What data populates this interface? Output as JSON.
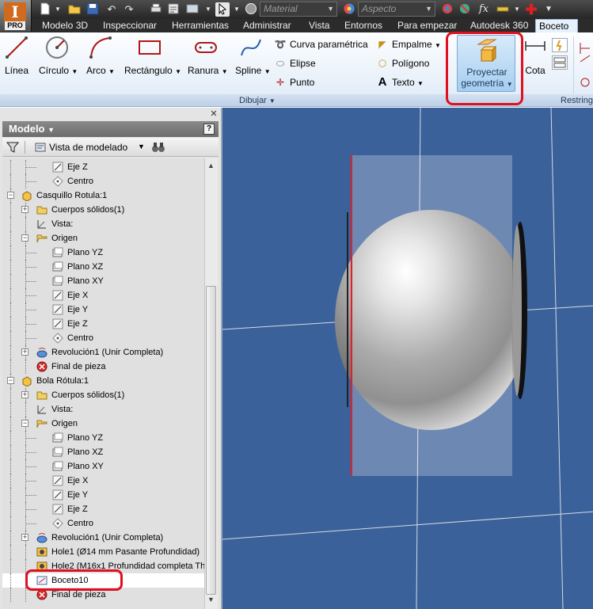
{
  "qat": {
    "material_placeholder": "Material",
    "aspecto_placeholder": "Aspecto",
    "app_badge": "PRO",
    "app_letter": "I",
    "fx_symbol": "fx"
  },
  "tabs": [
    "Modelo 3D",
    "Inspeccionar",
    "Herramientas",
    "Administrar",
    "Vista",
    "Entornos",
    "Para empezar",
    "Autodesk 360",
    "Boceto"
  ],
  "active_tab": "Boceto",
  "ribbon": {
    "draw_buttons": [
      "Línea",
      "Círculo",
      "Arco",
      "Rectángulo",
      "Ranura",
      "Spline"
    ],
    "small_col1": [
      "Curva paramétrica",
      "Elipse",
      "Punto"
    ],
    "small_col2": [
      "Empalme",
      "Polígono",
      "Texto"
    ],
    "project": {
      "line1": "Proyectar",
      "line2": "geometría"
    },
    "cota": "Cota",
    "panel_dibujar": "Dibujar",
    "panel_restring": "Restring"
  },
  "browser": {
    "title": "Modelo",
    "help": "?",
    "view_label": "Vista de modelado",
    "items": [
      {
        "label": "Eje Z",
        "icon": "axis-icon",
        "indent": 3,
        "pm": "",
        "sel": false
      },
      {
        "label": "Centro",
        "icon": "point-icon",
        "indent": 3,
        "pm": "",
        "sel": false
      },
      {
        "label": "Casquillo Rotula:1",
        "icon": "part-icon",
        "indent": 0,
        "pm": "-",
        "sel": false
      },
      {
        "label": "Cuerpos sólidos(1)",
        "icon": "folder-icon",
        "indent": 1,
        "pm": "+",
        "sel": false
      },
      {
        "label": "Vista:",
        "icon": "view-icon",
        "indent": 1,
        "pm": "",
        "sel": false
      },
      {
        "label": "Origen",
        "icon": "folder-open-icon",
        "indent": 1,
        "pm": "-",
        "sel": false
      },
      {
        "label": "Plano YZ",
        "icon": "plane-icon",
        "indent": 2,
        "pm": "",
        "sel": false
      },
      {
        "label": "Plano XZ",
        "icon": "plane-icon",
        "indent": 2,
        "pm": "",
        "sel": false
      },
      {
        "label": "Plano XY",
        "icon": "plane-icon",
        "indent": 2,
        "pm": "",
        "sel": false
      },
      {
        "label": "Eje X",
        "icon": "axis-icon",
        "indent": 2,
        "pm": "",
        "sel": false
      },
      {
        "label": "Eje Y",
        "icon": "axis-icon",
        "indent": 2,
        "pm": "",
        "sel": false
      },
      {
        "label": "Eje Z",
        "icon": "axis-icon",
        "indent": 2,
        "pm": "",
        "sel": false
      },
      {
        "label": "Centro",
        "icon": "point-icon",
        "indent": 2,
        "pm": "",
        "sel": false
      },
      {
        "label": "Revolución1 (Unir Completa)",
        "icon": "revolve-icon",
        "indent": 1,
        "pm": "+",
        "sel": false
      },
      {
        "label": "Final de pieza",
        "icon": "end-of-part-icon",
        "indent": 1,
        "pm": "",
        "sel": false
      },
      {
        "label": "Bola Rótula:1",
        "icon": "part-icon",
        "indent": 0,
        "pm": "-",
        "sel": false
      },
      {
        "label": "Cuerpos sólidos(1)",
        "icon": "folder-icon",
        "indent": 1,
        "pm": "+",
        "sel": false
      },
      {
        "label": "Vista:",
        "icon": "view-icon",
        "indent": 1,
        "pm": "",
        "sel": false
      },
      {
        "label": "Origen",
        "icon": "folder-open-icon",
        "indent": 1,
        "pm": "-",
        "sel": false
      },
      {
        "label": "Plano YZ",
        "icon": "plane-icon",
        "indent": 2,
        "pm": "",
        "sel": false
      },
      {
        "label": "Plano XZ",
        "icon": "plane-icon",
        "indent": 2,
        "pm": "",
        "sel": false
      },
      {
        "label": "Plano XY",
        "icon": "plane-icon",
        "indent": 2,
        "pm": "",
        "sel": false
      },
      {
        "label": "Eje X",
        "icon": "axis-icon",
        "indent": 2,
        "pm": "",
        "sel": false
      },
      {
        "label": "Eje Y",
        "icon": "axis-icon",
        "indent": 2,
        "pm": "",
        "sel": false
      },
      {
        "label": "Eje Z",
        "icon": "axis-icon",
        "indent": 2,
        "pm": "",
        "sel": false
      },
      {
        "label": "Centro",
        "icon": "point-icon",
        "indent": 2,
        "pm": "",
        "sel": false
      },
      {
        "label": "Revolución1 (Unir Completa)",
        "icon": "revolve-icon",
        "indent": 1,
        "pm": "+",
        "sel": false
      },
      {
        "label": "Hole1 (Ø14 mm Pasante Profundidad)",
        "icon": "hole-icon",
        "indent": 1,
        "pm": "",
        "sel": false
      },
      {
        "label": "Hole2 (M16x1 Profundidad completa Thr",
        "icon": "hole-icon",
        "indent": 1,
        "pm": "",
        "sel": false
      },
      {
        "label": "Boceto10",
        "icon": "sketch-icon",
        "indent": 1,
        "pm": "",
        "sel": true
      },
      {
        "label": "Final de pieza",
        "icon": "end-of-part-icon",
        "indent": 1,
        "pm": "",
        "sel": false
      }
    ]
  },
  "colors": {
    "viewport_bg": "#3a6199",
    "highlight_red": "#e01020",
    "sketch_line": "#e0202a"
  }
}
